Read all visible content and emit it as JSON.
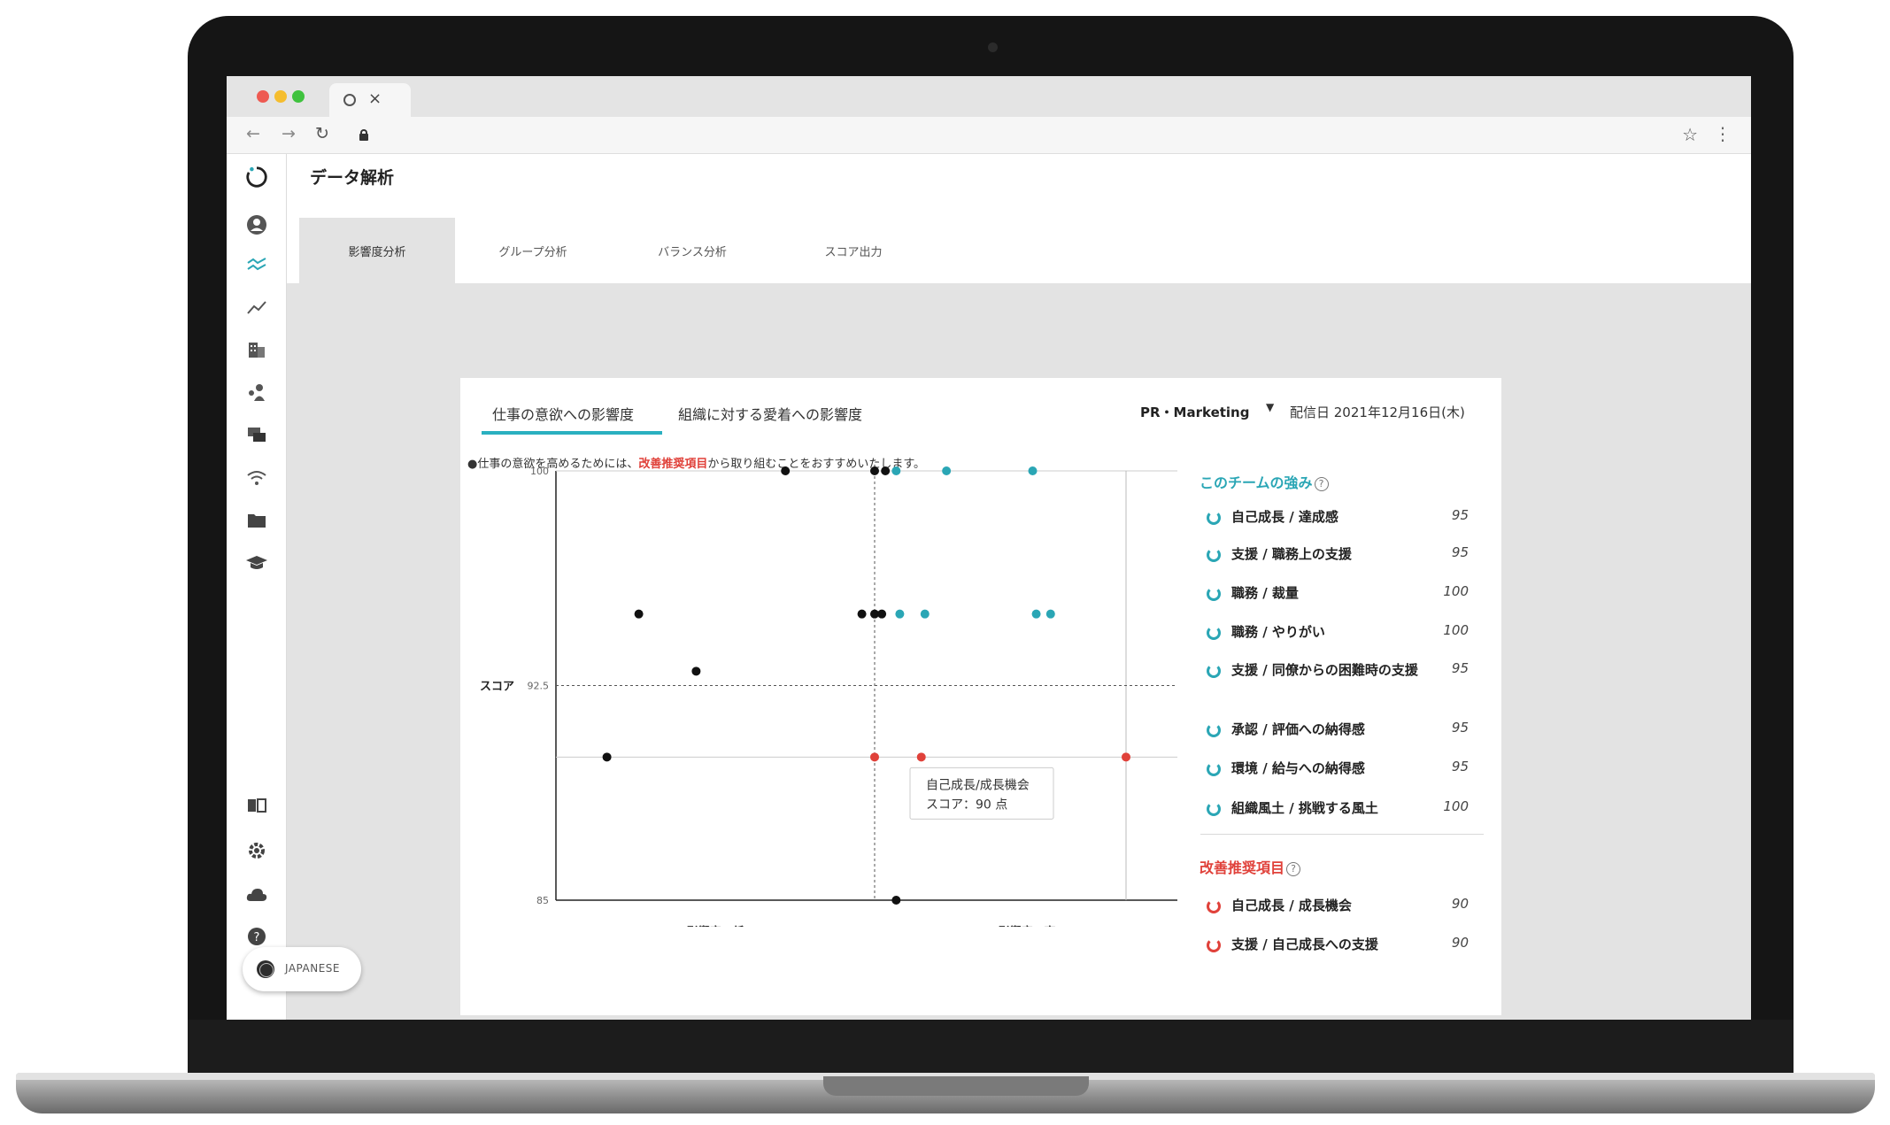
{
  "browser": {
    "tab_close": "×"
  },
  "header": {
    "title": "データ解析",
    "tabs": [
      {
        "label": "影響度分析",
        "active": true
      },
      {
        "label": "グループ分析",
        "active": false
      },
      {
        "label": "バランス分析",
        "active": false
      },
      {
        "label": "スコア出力",
        "active": false
      }
    ]
  },
  "panel": {
    "subtabs": [
      "仕事の意欲への影響度",
      "組織に対する愛着への影響度"
    ],
    "department": "PR・Marketing",
    "delivery_date": "配信日 2021年12月16日(木)",
    "recommendation_prefix": "●仕事の意欲を高めるためには、",
    "recommendation_highlight": "改善推奨項目",
    "recommendation_suffix": "から取り組むことをおすすめいたします。"
  },
  "chart_data": {
    "type": "scatter",
    "ylabel": "スコア",
    "xlabels": [
      "影響度：低",
      "影響度：高"
    ],
    "y_ticks": [
      "100",
      "92.5",
      "85"
    ],
    "ylim": [
      85,
      100
    ],
    "threshold_y": 92.5,
    "series": [
      {
        "color_role": "neutral",
        "points": [
          [
            -0.14,
            100
          ],
          [
            0.0,
            100
          ],
          [
            0.03,
            100
          ],
          [
            -0.37,
            95
          ],
          [
            -0.02,
            95
          ],
          [
            0.0,
            95
          ],
          [
            0.02,
            95
          ],
          [
            -0.28,
            93
          ],
          [
            -0.42,
            90
          ],
          [
            0.06,
            85
          ]
        ]
      },
      {
        "color_role": "strength",
        "points": [
          [
            0.06,
            100
          ],
          [
            0.2,
            100
          ],
          [
            0.44,
            100
          ],
          [
            0.07,
            95
          ],
          [
            0.14,
            95
          ],
          [
            0.45,
            95
          ],
          [
            0.49,
            95
          ]
        ]
      },
      {
        "color_role": "improvement",
        "points": [
          [
            0.0,
            90
          ],
          [
            0.13,
            90
          ],
          [
            0.7,
            90
          ]
        ]
      }
    ],
    "tooltip": {
      "label": "自己成長/成長機会",
      "score": "スコア：90 点"
    }
  },
  "strengths": {
    "title": "このチームの強み",
    "items": [
      {
        "label": "自己成長 / 達成感",
        "score": "95"
      },
      {
        "label": "支援 / 職務上の支援",
        "score": "95"
      },
      {
        "label": "職務 / 裁量",
        "score": "100"
      },
      {
        "label": "職務 / やりがい",
        "score": "100"
      },
      {
        "label": "支援 / 同僚からの困難時の支援",
        "score": "95"
      },
      {
        "label": "承認 / 評価への納得感",
        "score": "95"
      },
      {
        "label": "環境 / 給与への納得感",
        "score": "95"
      },
      {
        "label": "組織風土 / 挑戦する風土",
        "score": "100"
      }
    ]
  },
  "improvements": {
    "title": "改善推奨項目",
    "items": [
      {
        "label": "自己成長 / 成長機会",
        "score": "90"
      },
      {
        "label": "支援 / 自己成長への支援",
        "score": "90"
      }
    ]
  },
  "language": {
    "label": "JAPANESE"
  },
  "colors": {
    "teal": "#2aa6b5",
    "red": "#e0413a",
    "dot": "#111111"
  },
  "icons": [
    "refresh-logo-icon",
    "user-icon",
    "analysis-icon",
    "trend-icon",
    "building-icon",
    "people-icon",
    "chat-icon",
    "wifi-icon",
    "folder-icon",
    "graduation-icon",
    "book-icon",
    "gear-icon",
    "cloud-icon",
    "help-icon",
    "globe-icon"
  ]
}
